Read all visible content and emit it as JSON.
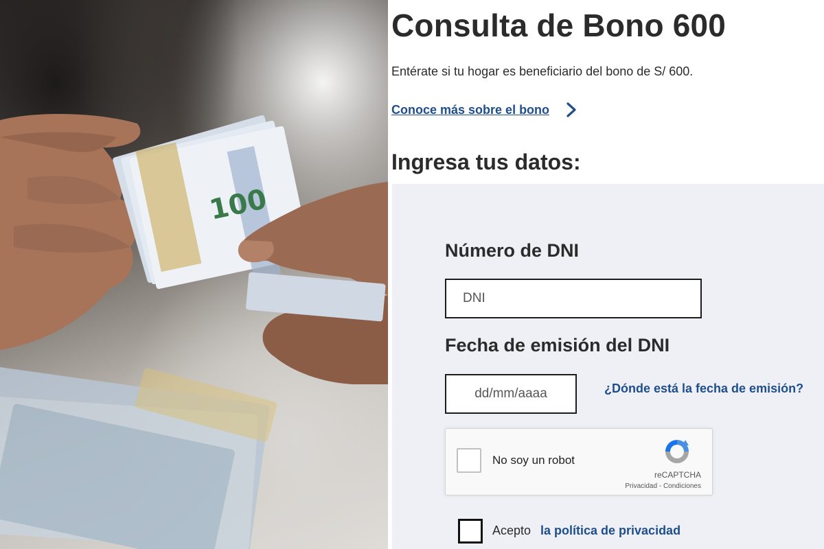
{
  "photo": {
    "alt_subject": "money-handover-photo",
    "banknote_value_text": "100"
  },
  "header": {
    "title": "Consulta de Bono 600",
    "description": "Entérate si tu hogar es beneficiario del bono de S/ 600.",
    "more_link": "Conoce más sobre el bono",
    "section_title": "Ingresa tus datos:"
  },
  "form": {
    "dni": {
      "label": "Número de DNI",
      "placeholder": "DNI",
      "value": ""
    },
    "fecha": {
      "label": "Fecha de emisión del DNI",
      "placeholder": "dd/mm/aaaa",
      "value": "",
      "help_link": "¿Dónde está la fecha de emisión?"
    },
    "recaptcha": {
      "label": "No soy un robot",
      "brand": "reCAPTCHA",
      "privacy": "Privacidad",
      "separator": " - ",
      "terms": "Condiciones",
      "checked": false
    },
    "consent": {
      "prefix": "Acepto",
      "link": "la política de privacidad",
      "checked": false
    }
  },
  "colors": {
    "link": "#1f4e8c",
    "text": "#2b2b2b",
    "form_bg": "#eef0f5",
    "input_border": "#1c1c1c"
  },
  "icons": {
    "more_link_icon": "chevron-right-icon",
    "recaptcha_icon": "recaptcha-logo-icon"
  }
}
